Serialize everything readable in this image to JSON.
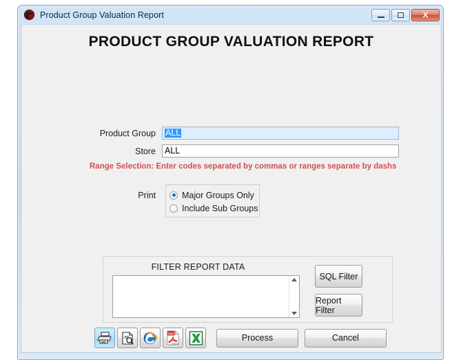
{
  "window": {
    "title": "Product Group Valuation Report",
    "app_icon": "globe-app-icon",
    "controls": {
      "minimize": "minimize-icon",
      "maximize": "maximize-icon",
      "close": "X"
    }
  },
  "heading": "PRODUCT GROUP VALUATION REPORT",
  "form": {
    "product_group": {
      "label": "Product Group",
      "value": "ALL",
      "selected": true
    },
    "store": {
      "label": "Store",
      "value": "ALL",
      "selected": false
    },
    "range_note": "Range Selection:  Enter codes separated by commas or ranges separate by dashs",
    "range_note_color": "#d05050"
  },
  "print": {
    "label": "Print",
    "options": [
      {
        "label": "Major Groups Only",
        "checked": true
      },
      {
        "label": "Include Sub Groups",
        "checked": false
      }
    ]
  },
  "filter_group": {
    "title": "FILTER REPORT DATA",
    "textarea_value": "",
    "textarea_placeholder": "",
    "scroll_up_icon": "scroll-up-arrow-icon",
    "scroll_down_icon": "scroll-down-arrow-icon",
    "buttons": [
      {
        "label": "SQL Filter"
      },
      {
        "label": "Report Filter"
      }
    ]
  },
  "action_bar": {
    "icons": [
      {
        "name": "printer-icon",
        "title": "Print",
        "active": true
      },
      {
        "name": "print-preview-icon",
        "title": "Print Preview",
        "active": false
      },
      {
        "name": "internet-explorer-icon",
        "title": "Export to HTML",
        "active": false
      },
      {
        "name": "pdf-adobe-icon",
        "title": "Export to PDF",
        "active": false,
        "badge": "PDF"
      },
      {
        "name": "excel-icon",
        "title": "Export to Excel",
        "active": false
      }
    ],
    "process_label": "Process",
    "cancel_label": "Cancel"
  },
  "colors": {
    "window_frame": "#7aa3c8",
    "client_bg": "#f0f0f0",
    "focus_field_bg": "#ddeeff",
    "selection_blue": "#3399ff",
    "radio_dot": "#1b6fc4",
    "close_button_red": "#c94f38"
  }
}
